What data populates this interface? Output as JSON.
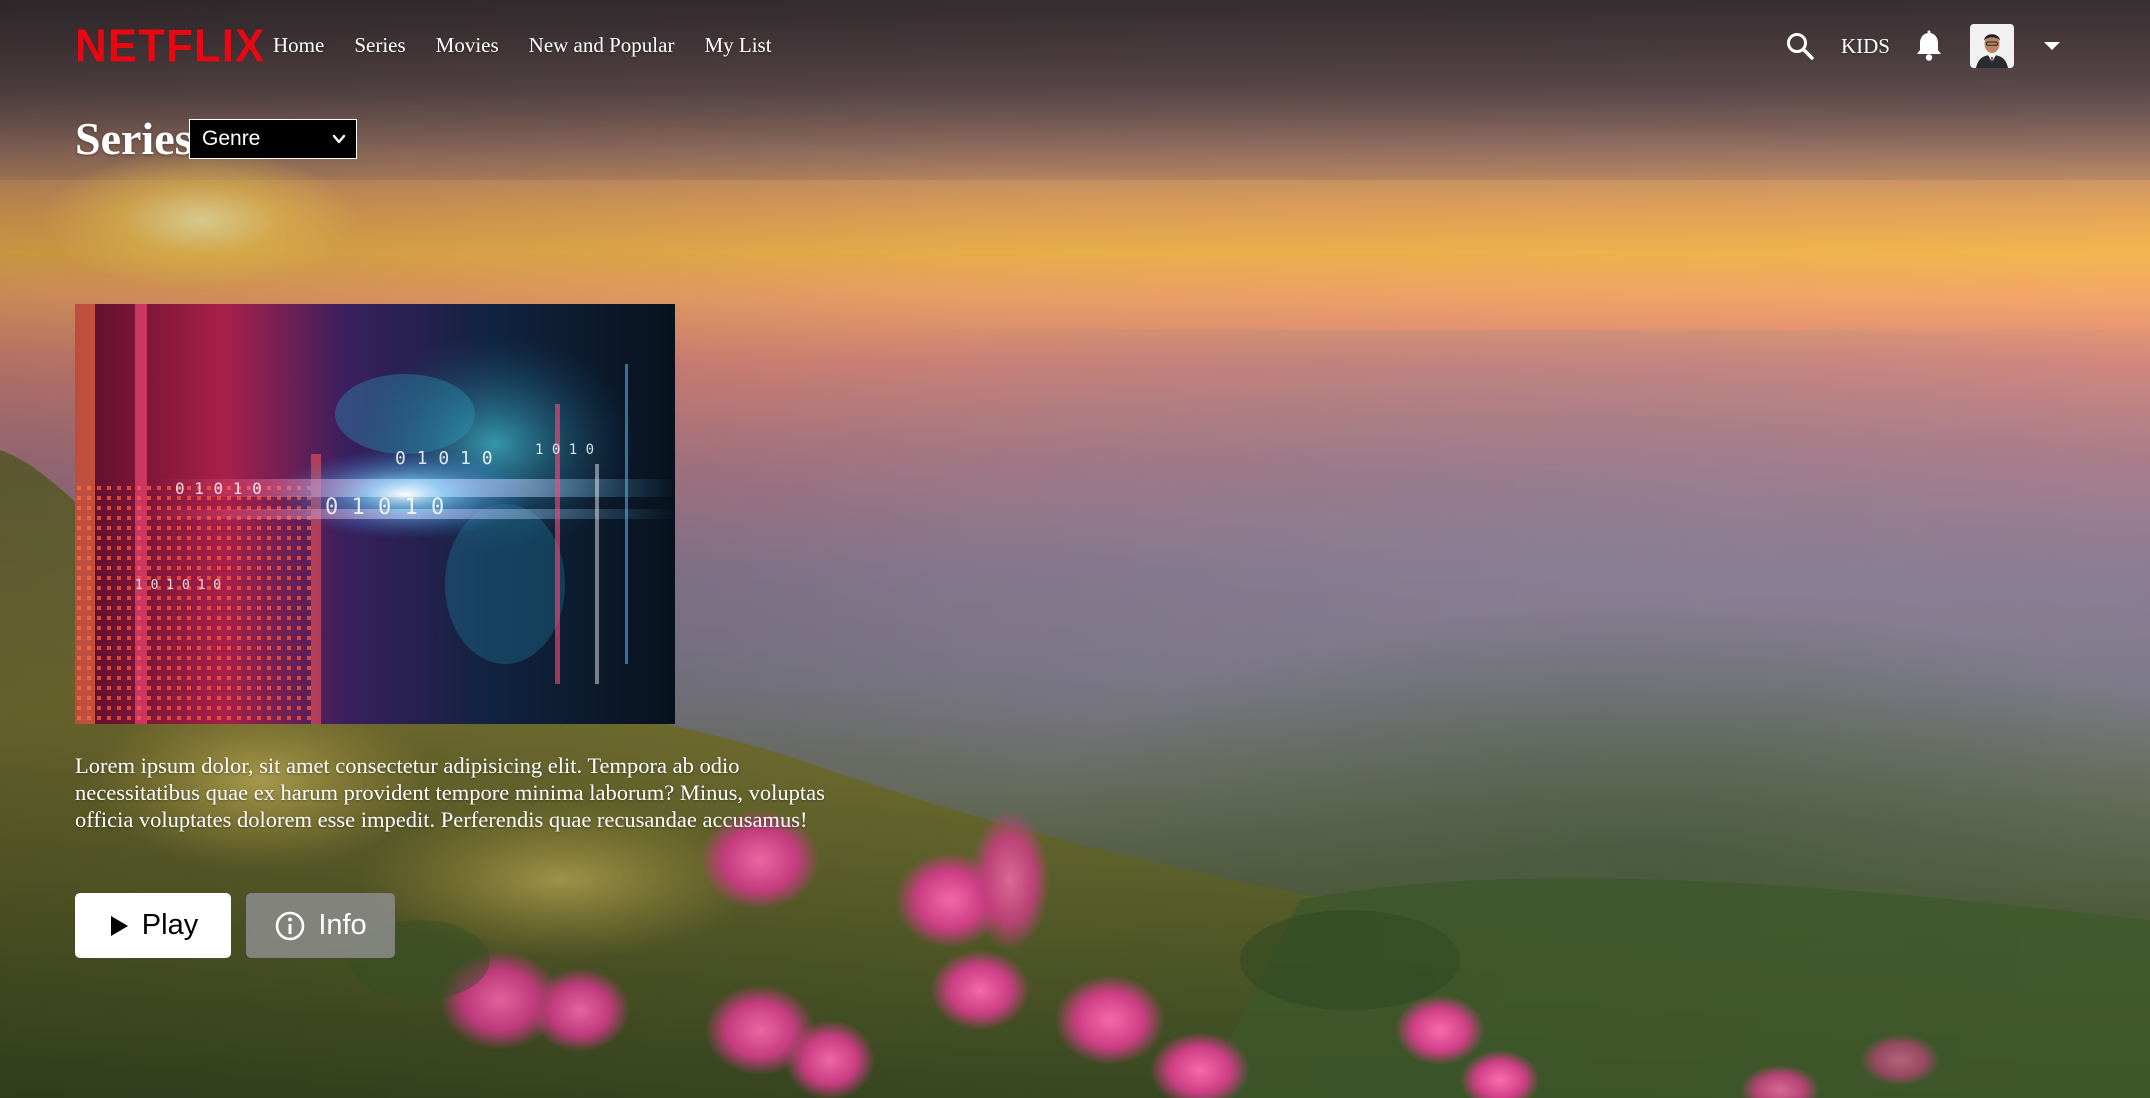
{
  "brand": {
    "logo_text": "NETFLIX",
    "logo_color": "#e50914"
  },
  "nav": {
    "links": [
      {
        "label": "Home"
      },
      {
        "label": "Series"
      },
      {
        "label": "Movies"
      },
      {
        "label": "New and Popular"
      },
      {
        "label": "My List"
      }
    ],
    "kids_label": "KIDS",
    "icons": {
      "search": "search-icon",
      "notifications": "bell-icon",
      "menu": "caret-down-icon"
    }
  },
  "page": {
    "title": "Series",
    "genre_select": {
      "selected": "Genre"
    }
  },
  "featured": {
    "description": "Lorem ipsum dolor, sit amet consectetur adipisicing elit. Tempora ab odio necessitatibus quae ex harum provident tempore minima laborum? Minus, voluptas officia voluptates dolorem esse impedit. Perferendis quae recusandae accusamus!",
    "play_label": "Play",
    "info_label": "Info",
    "icons": {
      "play": "play-icon",
      "info": "info-icon"
    }
  }
}
